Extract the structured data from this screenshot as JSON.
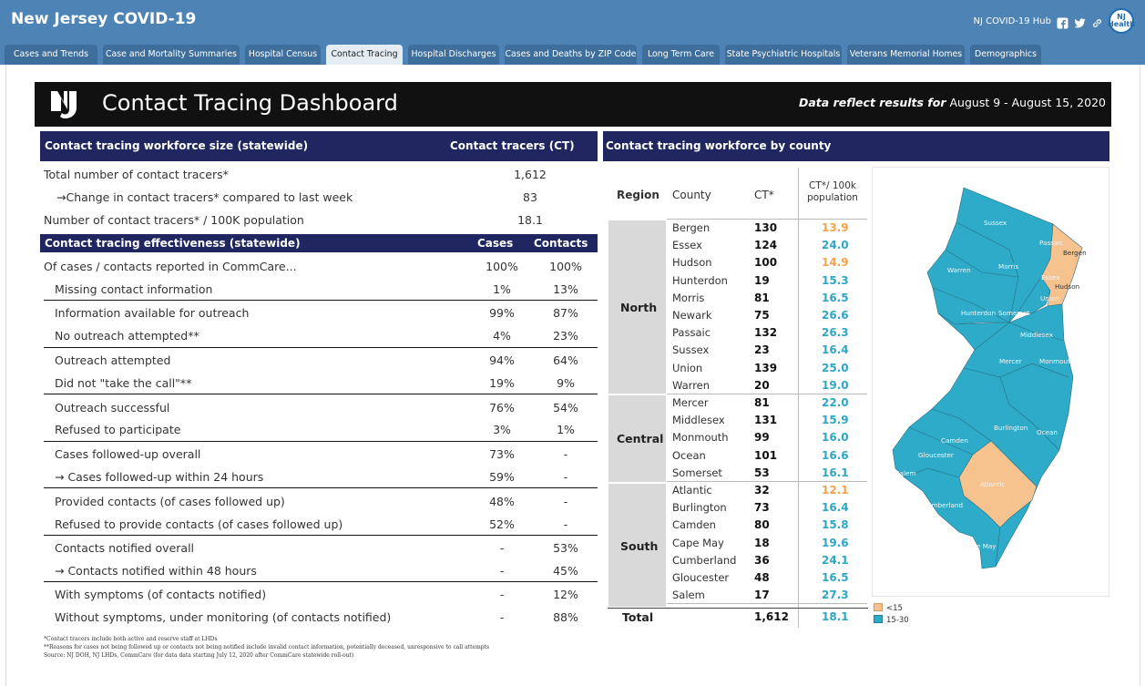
{
  "app": {
    "title": "New Jersey COVID-19",
    "hub_link": "NJ COVID-19 Hub",
    "logo_text": "NJ Health"
  },
  "tabs": [
    {
      "label": "Cases and Trends",
      "active": false
    },
    {
      "label": "Case and Mortality Summaries",
      "active": false
    },
    {
      "label": "Hospital Census",
      "active": false
    },
    {
      "label": "Contact Tracing",
      "active": true
    },
    {
      "label": "Hospital Discharges",
      "active": false
    },
    {
      "label": "Cases and Deaths by ZIP Code",
      "active": false
    },
    {
      "label": "Long Term Care",
      "active": false
    },
    {
      "label": "State Psychiatric Hospitals",
      "active": false
    },
    {
      "label": "Veterans Memorial Homes",
      "active": false
    },
    {
      "label": "Demographics",
      "active": false
    }
  ],
  "dashboard": {
    "title": "Contact Tracing Dashboard",
    "period_label": "Data reflect results for",
    "period": "August 9 - August 15, 2020"
  },
  "workforce": {
    "header": "Contact tracing workforce size (statewide)",
    "column": "Contact tracers (CT)",
    "rows": [
      {
        "label": "Total number of contact tracers*",
        "value": "1,612"
      },
      {
        "label": "→Change in contact tracers* compared to last week",
        "value": "83"
      },
      {
        "label": "Number of contact tracers* / 100K population",
        "value": "18.1"
      }
    ]
  },
  "effectiveness": {
    "header": "Contact tracing effectiveness (statewide)",
    "col_cases": "Cases",
    "col_contacts": "Contacts",
    "rows": [
      {
        "label": "Of cases / contacts reported in CommCare...",
        "cases": "100%",
        "contacts": "100%"
      },
      {
        "label": "Missing contact information",
        "cases": "1%",
        "contacts": "13%"
      },
      {
        "label": "Information available for outreach",
        "cases": "99%",
        "contacts": "87%"
      },
      {
        "label": "No outreach attempted**",
        "cases": "4%",
        "contacts": "23%"
      },
      {
        "label": "Outreach attempted",
        "cases": "94%",
        "contacts": "64%"
      },
      {
        "label": "Did not \"take the call\"**",
        "cases": "19%",
        "contacts": "9%"
      },
      {
        "label": "Outreach successful",
        "cases": "76%",
        "contacts": "54%"
      },
      {
        "label": "Refused to participate",
        "cases": "3%",
        "contacts": "1%"
      },
      {
        "label": "Cases followed-up overall",
        "cases": "73%",
        "contacts": "-"
      },
      {
        "label": "→ Cases followed-up within 24 hours",
        "cases": "59%",
        "contacts": "-"
      },
      {
        "label": "Provided contacts (of cases followed up)",
        "cases": "48%",
        "contacts": "-"
      },
      {
        "label": "Refused to provide contacts (of cases followed up)",
        "cases": "52%",
        "contacts": "-"
      },
      {
        "label": "Contacts notified overall",
        "cases": "-",
        "contacts": "53%"
      },
      {
        "label": "→ Contacts notified within 48 hours",
        "cases": "-",
        "contacts": "45%"
      },
      {
        "label": "With symptoms (of contacts notified)",
        "cases": "-",
        "contacts": "12%"
      },
      {
        "label": "Without symptoms, under monitoring (of contacts notified)",
        "cases": "-",
        "contacts": "88%"
      }
    ]
  },
  "county_table": {
    "header": "Contact tracing workforce by county",
    "col_region": "Region",
    "col_county": "County",
    "col_ct": "CT*",
    "col_rate": "CT*/ 100k population",
    "regions": [
      {
        "name": "North",
        "rows": [
          {
            "county": "Bergen",
            "ct": "130",
            "rate": "13.9",
            "band": "<15"
          },
          {
            "county": "Essex",
            "ct": "124",
            "rate": "24.0",
            "band": "15-30"
          },
          {
            "county": "Hudson",
            "ct": "100",
            "rate": "14.9",
            "band": "<15"
          },
          {
            "county": "Hunterdon",
            "ct": "19",
            "rate": "15.3",
            "band": "15-30"
          },
          {
            "county": "Morris",
            "ct": "81",
            "rate": "16.5",
            "band": "15-30"
          },
          {
            "county": "Newark",
            "ct": "75",
            "rate": "26.6",
            "band": "15-30"
          },
          {
            "county": "Passaic",
            "ct": "132",
            "rate": "26.3",
            "band": "15-30"
          },
          {
            "county": "Sussex",
            "ct": "23",
            "rate": "16.4",
            "band": "15-30"
          },
          {
            "county": "Union",
            "ct": "139",
            "rate": "25.0",
            "band": "15-30"
          },
          {
            "county": "Warren",
            "ct": "20",
            "rate": "19.0",
            "band": "15-30"
          }
        ]
      },
      {
        "name": "Central",
        "rows": [
          {
            "county": "Mercer",
            "ct": "81",
            "rate": "22.0",
            "band": "15-30"
          },
          {
            "county": "Middlesex",
            "ct": "131",
            "rate": "15.9",
            "band": "15-30"
          },
          {
            "county": "Monmouth",
            "ct": "99",
            "rate": "16.0",
            "band": "15-30"
          },
          {
            "county": "Ocean",
            "ct": "101",
            "rate": "16.6",
            "band": "15-30"
          },
          {
            "county": "Somerset",
            "ct": "53",
            "rate": "16.1",
            "band": "15-30"
          }
        ]
      },
      {
        "name": "South",
        "rows": [
          {
            "county": "Atlantic",
            "ct": "32",
            "rate": "12.1",
            "band": "<15"
          },
          {
            "county": "Burlington",
            "ct": "73",
            "rate": "16.4",
            "band": "15-30"
          },
          {
            "county": "Camden",
            "ct": "80",
            "rate": "15.8",
            "band": "15-30"
          },
          {
            "county": "Cape May",
            "ct": "18",
            "rate": "19.6",
            "band": "15-30"
          },
          {
            "county": "Cumberland",
            "ct": "36",
            "rate": "24.1",
            "band": "15-30"
          },
          {
            "county": "Gloucester",
            "ct": "48",
            "rate": "16.5",
            "band": "15-30"
          },
          {
            "county": "Salem",
            "ct": "17",
            "rate": "27.3",
            "band": "15-30"
          }
        ]
      }
    ],
    "total": {
      "label": "Total",
      "ct": "1,612",
      "rate": "18.1"
    }
  },
  "map": {
    "labels": [
      "Sussex",
      "Passaic",
      "Bergen",
      "Warren",
      "Morris",
      "Essex",
      "Hudson",
      "Union",
      "Hunterdon",
      "Somerset",
      "Middlesex",
      "Mercer",
      "Monmouth",
      "Burlington",
      "Camden",
      "Ocean",
      "Gloucester",
      "Salem",
      "Atlantic",
      "Cumberland",
      "Cape May"
    ],
    "legend": [
      {
        "label": "<15",
        "color": "#f6c28e"
      },
      {
        "label": "15-30",
        "color": "#2eabc9"
      }
    ]
  },
  "colors": {
    "nav": "#4e84b5",
    "section_header": "#1f2660",
    "rate_low": "#f3a24a",
    "rate_mid": "#2ea6c6"
  },
  "footnotes": [
    "*Contact tracers include both active and reserve staff at LHDs",
    "**Reasons for cases not being followed up or contacts not being notified include invalid contact information, potentially deceased, unresponsive to call attempts",
    "Source: NJ DOH, NJ LHDs, CommCare (for data data starting July 12, 2020 after CommCare statewide roll-out)"
  ]
}
